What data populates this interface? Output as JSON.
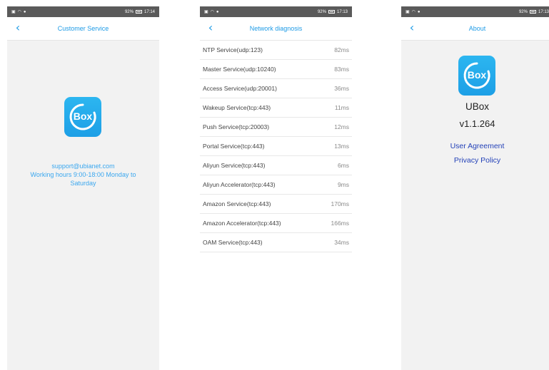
{
  "status_bar": {
    "left_icons": [
      "sim-icon",
      "wifi-icon",
      "location-icon"
    ],
    "screen1": {
      "signal": "92%",
      "time": "17:14"
    },
    "screen2": {
      "signal": "92%",
      "time": "17:13"
    },
    "screen3": {
      "signal": "92%",
      "time": "17:13"
    }
  },
  "customer_service": {
    "title": "Customer Service",
    "logo_text": "Box",
    "email": "support@ubianet.com",
    "hours_line1": "Working hours 9:00-18:00 Monday to",
    "hours_line2": "Saturday"
  },
  "network_diagnosis": {
    "title": "Network diagnosis",
    "rows": [
      {
        "service": "NTP Service(udp:123)",
        "latency": "82ms"
      },
      {
        "service": "Master Service(udp:10240)",
        "latency": "83ms"
      },
      {
        "service": "Access Service(udp:20001)",
        "latency": "36ms"
      },
      {
        "service": "Wakeup Service(tcp:443)",
        "latency": "11ms"
      },
      {
        "service": "Push Service(tcp:20003)",
        "latency": "12ms"
      },
      {
        "service": "Portal Service(tcp:443)",
        "latency": "13ms"
      },
      {
        "service": "Aliyun Service(tcp:443)",
        "latency": "6ms"
      },
      {
        "service": "Aliyun Accelerator(tcp:443)",
        "latency": "9ms"
      },
      {
        "service": "Amazon Service(tcp:443)",
        "latency": "170ms"
      },
      {
        "service": "Amazon Accelerator(tcp:443)",
        "latency": "166ms"
      },
      {
        "service": "OAM Service(tcp:443)",
        "latency": "34ms"
      }
    ]
  },
  "about": {
    "title": "About",
    "logo_text": "Box",
    "app_name": "UBox",
    "version": "v1.1.264",
    "user_agreement": "User Agreement",
    "privacy_policy": "Privacy Policy"
  },
  "colors": {
    "accent": "#1e9be6",
    "link": "#2442b8",
    "status_bar": "#5a5a5a",
    "background": "#f2f2f2"
  }
}
